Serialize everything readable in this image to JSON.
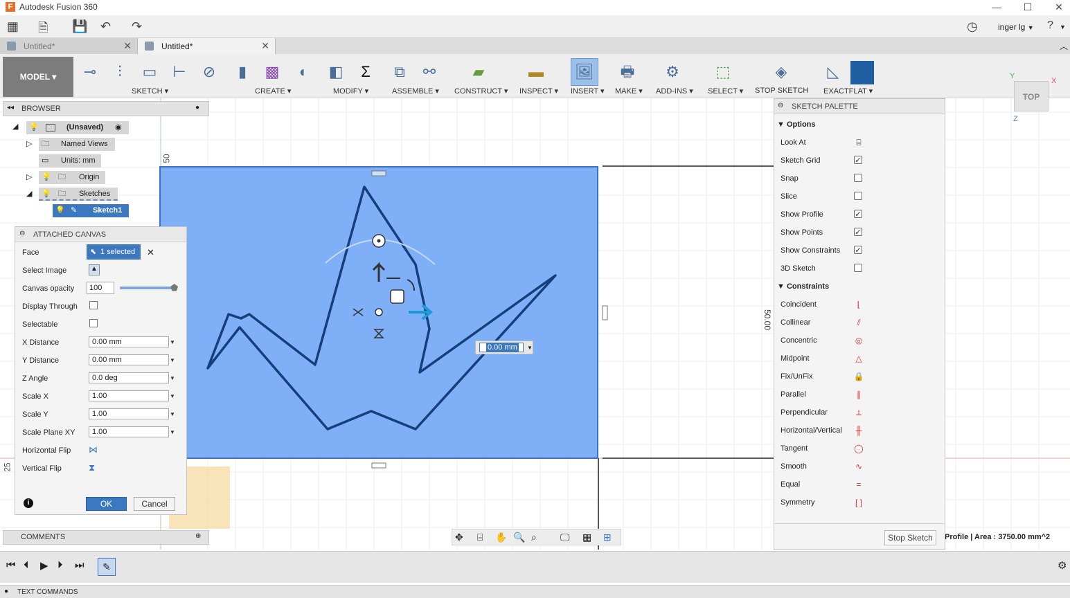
{
  "app": {
    "title": "Autodesk Fusion 360",
    "logo": "F"
  },
  "quick_access": {
    "user": "inger lg",
    "user_caret": "▼",
    "help_caret": "▼"
  },
  "tabs": [
    {
      "label": "Untitled*",
      "active": false
    },
    {
      "label": "Untitled*",
      "active": true
    }
  ],
  "ribbon": {
    "workspace": "MODEL ▾",
    "groups": [
      {
        "label": "SKETCH ▾"
      },
      {
        "label": "CREATE ▾"
      },
      {
        "label": "MODIFY ▾"
      },
      {
        "label": "ASSEMBLE ▾"
      },
      {
        "label": "CONSTRUCT ▾"
      },
      {
        "label": "INSPECT ▾"
      },
      {
        "label": "INSERT ▾"
      },
      {
        "label": "MAKE ▾"
      },
      {
        "label": "ADD-INS ▾"
      },
      {
        "label": "SELECT ▾"
      },
      {
        "label": "STOP SKETCH"
      },
      {
        "label": "EXACTFLAT ▾"
      }
    ]
  },
  "browser": {
    "title": "BROWSER",
    "nodes": [
      {
        "label": "(Unsaved)"
      },
      {
        "label": "Named Views"
      },
      {
        "label": "Units: mm"
      },
      {
        "label": "Origin"
      },
      {
        "label": "Sketches"
      },
      {
        "label": "Sketch1"
      }
    ]
  },
  "attached_canvas": {
    "title": "ATTACHED CANVAS",
    "face_label": "Face",
    "face_value": "1 selected",
    "select_image_label": "Select Image",
    "opacity_label": "Canvas opacity",
    "opacity_value": "100",
    "opacity_level": 1.0,
    "display_through_label": "Display Through",
    "selectable_label": "Selectable",
    "fields": [
      {
        "label": "X Distance",
        "value": "0.00 mm"
      },
      {
        "label": "Y Distance",
        "value": "0.00 mm"
      },
      {
        "label": "Z Angle",
        "value": "0.0 deg"
      },
      {
        "label": "Scale X",
        "value": "1.00"
      },
      {
        "label": "Scale Y",
        "value": "1.00"
      },
      {
        "label": "Scale Plane XY",
        "value": "1.00"
      }
    ],
    "hflip_label": "Horizontal Flip",
    "vflip_label": "Vertical Flip",
    "ok": "OK",
    "cancel": "Cancel"
  },
  "viewport": {
    "dim_top": "50",
    "dim_right": "50.00",
    "dim_left": "25",
    "inline_input": "0.00 mm",
    "viewcube": "TOP",
    "axis_x": "X",
    "axis_y": "Y",
    "axis_z": "Z",
    "status": "Profile | Area : 3750.00 mm^2"
  },
  "sketch_palette": {
    "title": "SKETCH PALETTE",
    "options_title": "Options",
    "options": [
      {
        "label": "Look At",
        "checked": null
      },
      {
        "label": "Sketch Grid",
        "checked": true
      },
      {
        "label": "Snap",
        "checked": false
      },
      {
        "label": "Slice",
        "checked": false
      },
      {
        "label": "Show Profile",
        "checked": true
      },
      {
        "label": "Show Points",
        "checked": true
      },
      {
        "label": "Show Constraints",
        "checked": true
      },
      {
        "label": "3D Sketch",
        "checked": false
      }
    ],
    "constraints_title": "Constraints",
    "constraints": [
      {
        "label": "Coincident",
        "icon": "coincident-icon",
        "glyph": "⌊"
      },
      {
        "label": "Collinear",
        "icon": "collinear-icon",
        "glyph": "⫽"
      },
      {
        "label": "Concentric",
        "icon": "concentric-icon",
        "glyph": "◎"
      },
      {
        "label": "Midpoint",
        "icon": "midpoint-icon",
        "glyph": "△"
      },
      {
        "label": "Fix/UnFix",
        "icon": "lock-icon",
        "glyph": "🔒"
      },
      {
        "label": "Parallel",
        "icon": "parallel-icon",
        "glyph": "∥"
      },
      {
        "label": "Perpendicular",
        "icon": "perpendicular-icon",
        "glyph": "⟂"
      },
      {
        "label": "Horizontal/Vertical",
        "icon": "horizontal-vertical-icon",
        "glyph": "╫"
      },
      {
        "label": "Tangent",
        "icon": "tangent-icon",
        "glyph": "◯"
      },
      {
        "label": "Smooth",
        "icon": "smooth-icon",
        "glyph": "∿"
      },
      {
        "label": "Equal",
        "icon": "equal-icon",
        "glyph": "="
      },
      {
        "label": "Symmetry",
        "icon": "symmetry-icon",
        "glyph": "[ ]"
      }
    ],
    "stop_sketch": "Stop Sketch"
  },
  "comments": {
    "title": "COMMENTS"
  },
  "text_commands": {
    "title": "TEXT COMMANDS"
  },
  "colors": {
    "canvas_blue": "#7fb0f7",
    "accent": "#3c78c0",
    "crane_stroke": "#163e7a",
    "red_constraint": "#d9302c"
  }
}
